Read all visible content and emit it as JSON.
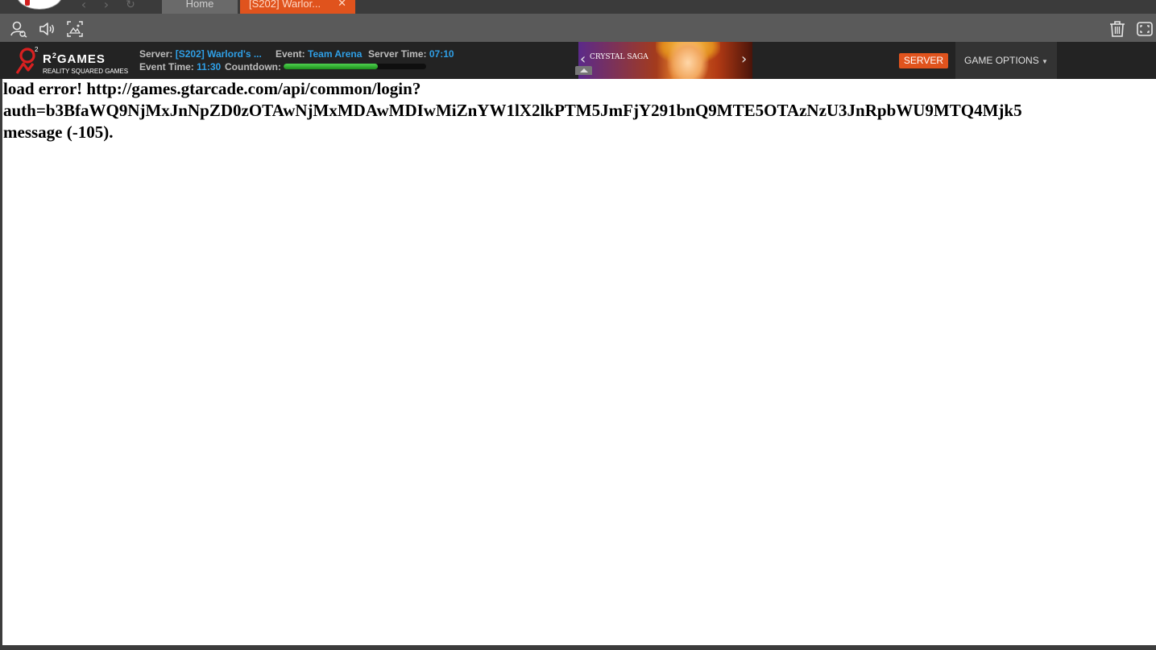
{
  "tabs": {
    "home_label": "Home",
    "active_label": "[S202] Warlor...",
    "close_glyph": "✕"
  },
  "nav": {
    "back_glyph": "‹",
    "forward_glyph": "›",
    "reload_glyph": "↻"
  },
  "toolbar": {
    "icons": [
      "account-search-icon",
      "volume-icon",
      "screenshot-icon",
      "trash-icon",
      "fullscreen-icon"
    ]
  },
  "brand": {
    "name": "R",
    "name_sup": "2",
    "name_rest": "GAMES",
    "tagline": "REALITY SQUARED GAMES"
  },
  "game_info": {
    "server_label": "Server:",
    "server_value": "[S202] Warlord's ...",
    "event_label": "Event:",
    "event_value": "Team Arena",
    "server_time_label": "Server Time:",
    "server_time_value": "07:10",
    "event_time_label": "Event Time:",
    "event_time_value": "11:30",
    "countdown_label": "Countdown:",
    "countdown_progress": 0.66
  },
  "banner": {
    "title": "CRYSTAL SAGA",
    "prev_glyph": "‹",
    "next_glyph": "›"
  },
  "buttons": {
    "server": "SERVER",
    "game_options": "GAME OPTIONS",
    "game_options_caret": "▼"
  },
  "error": {
    "line1": "load error! http://games.gtarcade.com/api/common/login?",
    "line2": "auth=b3BfaWQ9NjMxJnNpZD0zOTAwNjMxMDAwMDIwMiZnYW1lX2lkPTM5JmFjY291bnQ9MTE5OTAzNzU3JnRpbWU9MTQ4Mjk5",
    "line3": "message (-105)."
  },
  "colors": {
    "accent": "#e0531d",
    "link_blue": "#2f9fe6",
    "progress_green": "#2fb32f"
  }
}
